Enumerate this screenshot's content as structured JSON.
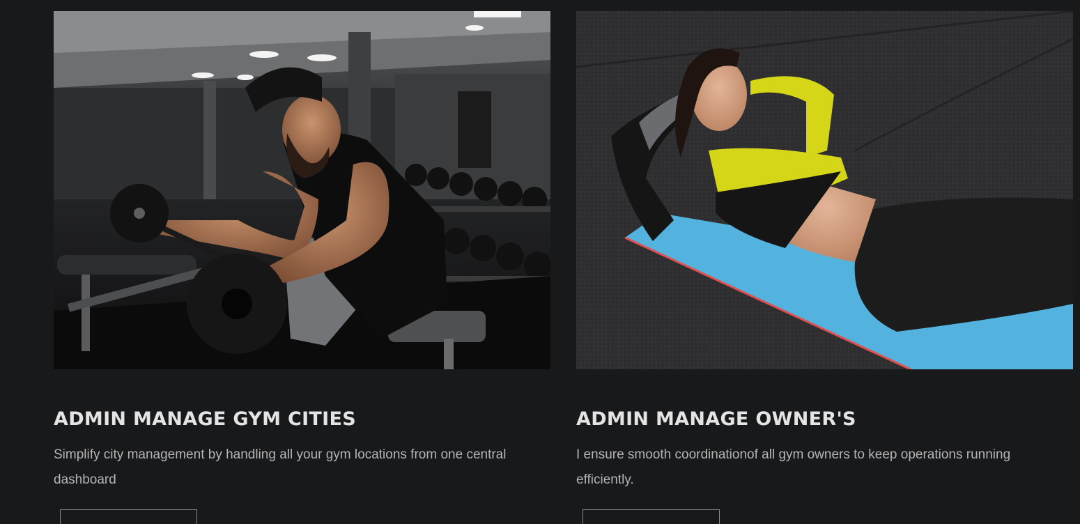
{
  "cards": [
    {
      "title": "ADMIN MANAGE GYM CITIES",
      "description": "Simplify city management by handling all your gym locations from one central dashboard",
      "image_subject": "man doing barbell curls on preacher bench in gym"
    },
    {
      "title": "ADMIN MANAGE OWNER'S",
      "description": "I ensure smooth coordinationof all gym owners to keep operations running efficiently.",
      "image_subject": "woman doing sit-ups on blue yoga mat"
    }
  ],
  "colors": {
    "background": "#18191b",
    "title": "#e4e4e4",
    "description": "#b4b4b4",
    "button_border": "#8a8a8a"
  }
}
